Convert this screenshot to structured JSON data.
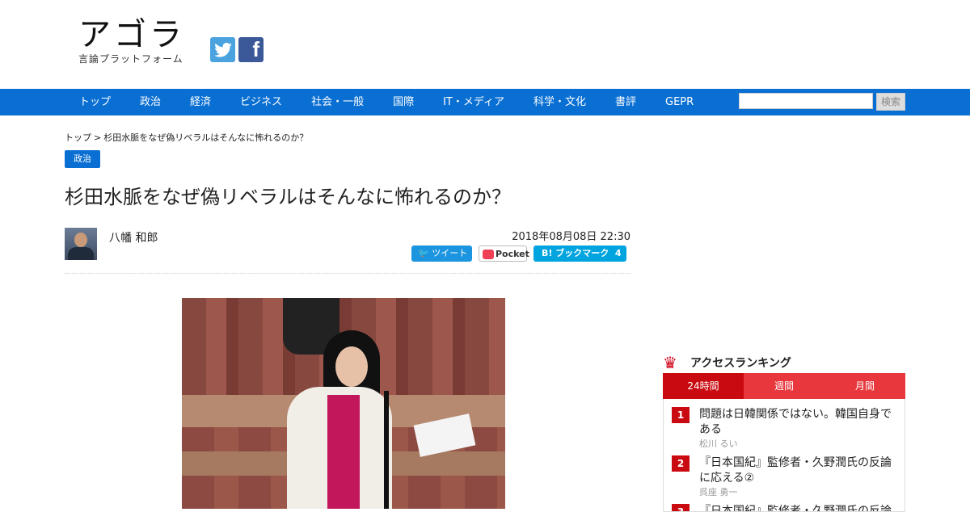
{
  "site": {
    "logo_title": "アゴラ",
    "logo_sub": "言論プラットフォーム",
    "social": [
      {
        "icon": "twitter-icon",
        "glyph": "🐦"
      },
      {
        "icon": "facebook-icon",
        "glyph": "f"
      }
    ]
  },
  "nav": {
    "items": [
      "トップ",
      "政治",
      "経済",
      "ビジネス",
      "社会・一般",
      "国際",
      "IT・メディア",
      "科学・文化",
      "書評",
      "GEPR"
    ],
    "search_button": "検索",
    "accent_color": "#0a6fd3"
  },
  "breadcrumb": {
    "home": "トップ",
    "separator": ">",
    "current": "杉田水脈をなぜ偽リベラルはそんなに怖れるのか？"
  },
  "article": {
    "category": "政治",
    "title": "杉田水脈をなぜ偽リベラルはそんなに怖れるのか？",
    "author": "八幡 和郎",
    "date": "2018年08月08日 22:30",
    "share": {
      "tweet": "ツイート",
      "pocket": "Pocket",
      "hatena": "B! ブックマーク",
      "hatena_count": "4"
    }
  },
  "ranking": {
    "title": "アクセスランキング",
    "tabs": [
      "24時間",
      "週間",
      "月間"
    ],
    "active_tab": "24時間",
    "items": [
      {
        "rank": "1",
        "title": "問題は日韓関係ではない。韓国自身である",
        "author": "松川 るい"
      },
      {
        "rank": "2",
        "title": "『日本国紀』監修者・久野潤氏の反論に応える②",
        "author": "呉座 勇一"
      },
      {
        "rank": "3",
        "title": "『日本国紀』監修者・久野潤氏の反論",
        "author": ""
      }
    ],
    "accent_color": "#c90a10"
  }
}
